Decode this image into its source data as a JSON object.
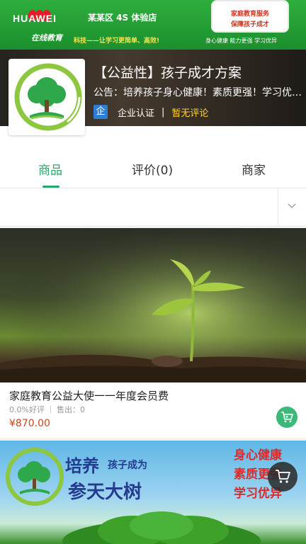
{
  "header": {
    "banner_brand": "HUAWEI",
    "banner_store": "某某区 4S 体验店",
    "banner_online": "在线教育",
    "banner_slogan": "科技——让学习更简单、高效!",
    "banner_tags": "身心健康  能力更强  学习优异",
    "banner_badge_line1": "家庭教育服务",
    "banner_badge_line2": "保障孩子成才",
    "shop_name": "【公益性】孩子成才方案",
    "notice": "公告：培养孩子身心健康！素质更强！学习优异！",
    "cert_icon_char": "企",
    "cert_label": "企业认证",
    "cert_separator": "|",
    "review_label": "暂无评论"
  },
  "tabs": {
    "goods": "商品",
    "reviews": "评价(0)",
    "merchant": "商家",
    "active": "goods",
    "accent_color": "#2aa56b"
  },
  "product": {
    "title": "家庭教育公益大使一一年度会员费",
    "rating": "0.0%好评",
    "sold": "售出：0",
    "price": "¥870.00",
    "cart_icon": "cart-icon"
  },
  "banner2": {
    "line_main": "培养",
    "line_sub": "孩子成为",
    "line_big": "参天大树",
    "right_col": [
      "身心健康",
      "素质更强",
      "学习优异"
    ]
  },
  "colors": {
    "accent": "#2aa56b",
    "price": "#c8471e",
    "cart": "#3bb978",
    "cert": "#2d7fd6",
    "review": "#ffd33a"
  }
}
